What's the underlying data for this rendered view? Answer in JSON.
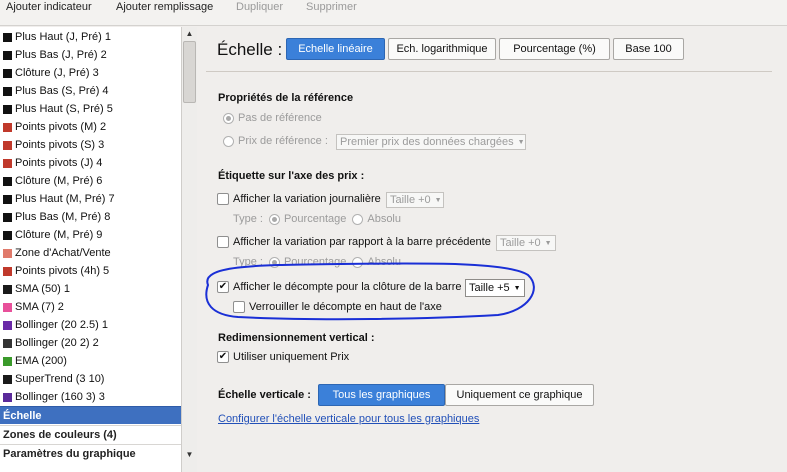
{
  "toolbar": {
    "add_indicator": "Ajouter indicateur",
    "add_fill": "Ajouter remplissage",
    "duplicate": "Dupliquer",
    "delete": "Supprimer"
  },
  "sidebar": {
    "items": [
      {
        "label": "Plus Haut (J, Pré) 1",
        "color": "#111111"
      },
      {
        "label": "Plus Bas (J, Pré) 2",
        "color": "#111111"
      },
      {
        "label": "Clôture (J, Pré) 3",
        "color": "#111111"
      },
      {
        "label": "Plus Bas (S, Pré) 4",
        "color": "#111111"
      },
      {
        "label": "Plus Haut (S, Pré) 5",
        "color": "#111111"
      },
      {
        "label": "Points pivots (M) 2",
        "color": "#c0392b"
      },
      {
        "label": "Points pivots (S) 3",
        "color": "#c0392b"
      },
      {
        "label": "Points pivots (J) 4",
        "color": "#c0392b"
      },
      {
        "label": "Clôture (M, Pré) 6",
        "color": "#111111"
      },
      {
        "label": "Plus Haut (M, Pré) 7",
        "color": "#111111"
      },
      {
        "label": "Plus Bas (M, Pré) 8",
        "color": "#111111"
      },
      {
        "label": "Clôture (M, Pré) 9",
        "color": "#111111"
      },
      {
        "label": "Zone d'Achat/Vente",
        "color": "#e07a6b"
      },
      {
        "label": "Points pivots (4h) 5",
        "color": "#c0392b"
      },
      {
        "label": "SMA (50) 1",
        "color": "#1a1a1a"
      },
      {
        "label": "SMA (7) 2",
        "color": "#e8509a"
      },
      {
        "label": "Bollinger (20 2.5) 1",
        "color": "#6a2aa8"
      },
      {
        "label": "Bollinger (20 2) 2",
        "color": "#333333"
      },
      {
        "label": "EMA (200)",
        "color": "#3a9a2a"
      },
      {
        "label": "SuperTrend (3 10)",
        "color": "#1a1a1a"
      },
      {
        "label": "Bollinger (160 3) 3",
        "color": "#5a2a9a"
      }
    ],
    "sections": [
      "Échelle",
      "Zones de couleurs (4)",
      "Paramètres du graphique"
    ]
  },
  "main": {
    "title": "Échelle :",
    "scale_buttons": [
      "Echelle linéaire",
      "Ech. logarithmique",
      "Pourcentage (%)",
      "Base 100"
    ],
    "ref_props": {
      "title": "Propriétés de la référence",
      "step": "Pas de référence",
      "price": "Prix de référence :",
      "price_dropdown": "Premier prix des données chargées"
    },
    "axis_label": {
      "title": "Étiquette sur l'axe des prix :",
      "daily_var": "Afficher la variation journalière",
      "size_0": "Taille +0",
      "type_label": "Type :",
      "percent": "Pourcentage",
      "absolute": "Absolu",
      "prev_bar_var": "Afficher la variation par rapport à la barre précédente",
      "countdown": "Afficher le décompte pour la clôture de la barre",
      "size_5": "Taille +5",
      "lock_countdown": "Verrouiller le décompte en haut de l'axe"
    },
    "resize": {
      "title": "Redimensionnement vertical :",
      "only_price": "Utiliser uniquement Prix"
    },
    "vertical_scale": {
      "title": "Échelle verticale :",
      "all": "Tous les graphiques",
      "only_this": "Uniquement ce graphique"
    },
    "link": "Configurer l'échelle verticale pour tous les graphiques"
  },
  "annotation_color": "#1a2fd6"
}
